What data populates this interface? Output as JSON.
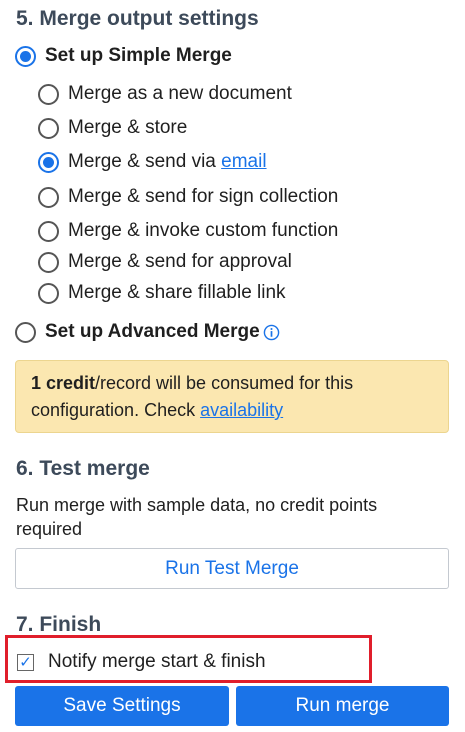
{
  "section5": {
    "title": "5. Merge output settings",
    "simple_merge_label": "Set up Simple Merge",
    "simple_options": [
      {
        "label": "Merge as a new document"
      },
      {
        "label": "Merge & store"
      },
      {
        "label": "Merge & send via ",
        "link": "email"
      },
      {
        "label": "Merge & send for sign collection"
      },
      {
        "label": "Merge & invoke custom function"
      },
      {
        "label": "Merge & send for approval"
      },
      {
        "label": "Merge & share fillable link"
      }
    ],
    "selected_option_index": 2,
    "advanced_merge_label": "Set up Advanced Merge",
    "info_icon": "info-icon"
  },
  "notice": {
    "credit_bold": "1 credit",
    "text_after_bold": "/record will be consumed for this configuration. Check ",
    "link": "availability",
    "bg_color": "#fbe7b0"
  },
  "section6": {
    "title": "6. Test merge",
    "description": "Run merge with sample data, no credit points required",
    "button_label": "Run Test Merge"
  },
  "section7": {
    "title": "7. Finish",
    "notify_label": "Notify merge start & finish",
    "notify_checked": true,
    "save_label": "Save Settings",
    "run_label": "Run merge"
  },
  "colors": {
    "accent": "#1a73e8",
    "highlight_border": "#e01e2b"
  }
}
